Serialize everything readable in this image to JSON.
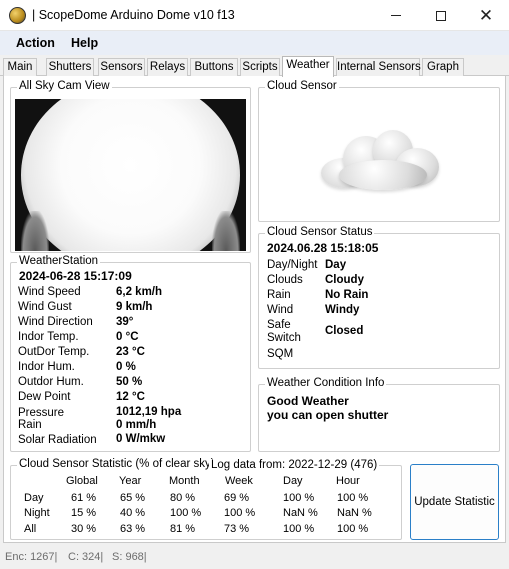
{
  "window": {
    "title": "| ScopeDome Arduino Dome v10 f13",
    "minimize_label": "—",
    "maximize_label": "▢",
    "close_label": "✕"
  },
  "menu": [
    "Action",
    "Help"
  ],
  "tabs": [
    {
      "label": "Main",
      "active": false
    },
    {
      "label": "Shutters",
      "active": false
    },
    {
      "label": "Sensors",
      "active": false
    },
    {
      "label": "Relays",
      "active": false
    },
    {
      "label": "Buttons",
      "active": false
    },
    {
      "label": "Scripts",
      "active": false
    },
    {
      "label": "Weather",
      "active": true
    },
    {
      "label": "Internal Sensors",
      "active": false
    },
    {
      "label": "Graph",
      "active": false
    }
  ],
  "allsky": {
    "title": "All Sky Cam View"
  },
  "cloud_sensor": {
    "title": "Cloud Sensor"
  },
  "cloud_status": {
    "title": "Cloud Sensor Status",
    "timestamp": "2024.06.28 15:18:05",
    "rows": [
      {
        "label": "Day/Night",
        "value": "Day"
      },
      {
        "label": "Clouds",
        "value": "Cloudy"
      },
      {
        "label": "Rain",
        "value": "No Rain"
      },
      {
        "label": "Wind",
        "value": "Windy"
      },
      {
        "label": "Safe Switch",
        "value": "Closed"
      },
      {
        "label": "SQM",
        "value": ""
      }
    ]
  },
  "weather_station": {
    "title": "WeatherStation",
    "timestamp": "2024-06-28 15:17:09",
    "rows": [
      {
        "label": "Wind Speed",
        "value": "6,2 km/h"
      },
      {
        "label": "Wind Gust",
        "value": "9 km/h"
      },
      {
        "label": "Wind Direction",
        "value": "39°"
      },
      {
        "label": "Indor Temp.",
        "value": "0  °C"
      },
      {
        "label": "OutDor Temp.",
        "value": "23  °C"
      },
      {
        "label": "Indor Hum.",
        "value": "0 %"
      },
      {
        "label": "Outdor Hum.",
        "value": "50 %"
      },
      {
        "label": "Dew Point",
        "value": "12 °C"
      },
      {
        "label": "Pressure",
        "value": "1012,19 hpa"
      },
      {
        "label": "Rain",
        "value": "0 mm/h"
      },
      {
        "label": "Solar Radiation",
        "value": "0 W/mkw"
      }
    ]
  },
  "weather_condition": {
    "title": "Weather Condition Info",
    "line1": "Good Weather",
    "line2": "you can open shutter"
  },
  "statistic": {
    "title": "Cloud Sensor Statistic (% of clear sky)",
    "log_info": "Log data from: 2022-12-29 (476)",
    "columns": [
      "Global",
      "Year",
      "Month",
      "Week",
      "Day",
      "Hour"
    ],
    "rows": [
      {
        "label": "Day",
        "values": [
          "61 %",
          "65 %",
          "80 %",
          "69 %",
          "100 %",
          "100 %"
        ]
      },
      {
        "label": "Night",
        "values": [
          "15 %",
          "40 %",
          "100 %",
          "100 %",
          "NaN %",
          "NaN %"
        ]
      },
      {
        "label": "All",
        "values": [
          "30 %",
          "63 %",
          "81 %",
          "73 %",
          "100 %",
          "100 %"
        ]
      }
    ],
    "button_label": "Update Statistic"
  },
  "statusbar": [
    "Enc: 1267|",
    "C: 324|",
    "S: 968|"
  ]
}
